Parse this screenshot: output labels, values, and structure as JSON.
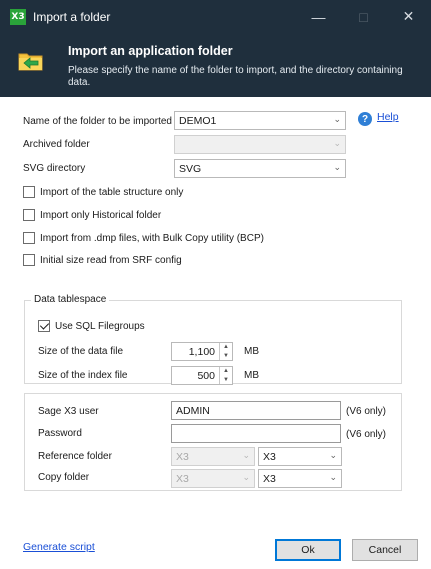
{
  "window": {
    "app_icon": "X3",
    "title": "Import a folder",
    "minimize_glyph": "—",
    "maximize_glyph": "□",
    "close_glyph": "✕"
  },
  "header": {
    "title": "Import an application folder",
    "subtitle": "Please specify the name of the folder to import, and the directory containing data."
  },
  "form": {
    "folder_name_label": "Name of the folder to be imported",
    "folder_name_value": "DEMO1",
    "help_glyph": "?",
    "help_label": "Help",
    "archived_label": "Archived folder",
    "archived_value": "",
    "svg_dir_label": "SVG directory",
    "svg_dir_value": "SVG"
  },
  "options": [
    {
      "label": "Import of the table structure only",
      "checked": false
    },
    {
      "label": "Import only Historical folder",
      "checked": false
    },
    {
      "label": "Import from .dmp files, with Bulk Copy utility (BCP)",
      "checked": false
    },
    {
      "label": "Initial size read from SRF config",
      "checked": false
    }
  ],
  "tablespace": {
    "title": "Data tablespace",
    "use_filegroups_label": "Use SQL Filegroups",
    "use_filegroups_checked": true,
    "data_file_label": "Size of the data file",
    "data_file_value": "1,100",
    "index_file_label": "Size of the index file",
    "index_file_value": "500",
    "unit": "MB"
  },
  "users": {
    "sage_user_label": "Sage X3 user",
    "sage_user_value": "ADMIN",
    "v6_note": "(V6 only)",
    "password_label": "Password",
    "password_value": "",
    "reference_label": "Reference folder",
    "reference_left": "X3",
    "reference_right": "X3",
    "copy_label": "Copy folder",
    "copy_left": "X3",
    "copy_right": "X3"
  },
  "footer": {
    "generate_script": "Generate script",
    "ok": "Ok",
    "cancel": "Cancel"
  },
  "colors": {
    "header_bg": "#1f2f3d",
    "accent": "#0078d7",
    "link": "#1a4fd6",
    "app_icon": "#2aa33a"
  },
  "icons": {
    "header": "folder-import-icon",
    "help": "help-icon",
    "dropdown": "chevron-down-icon"
  }
}
